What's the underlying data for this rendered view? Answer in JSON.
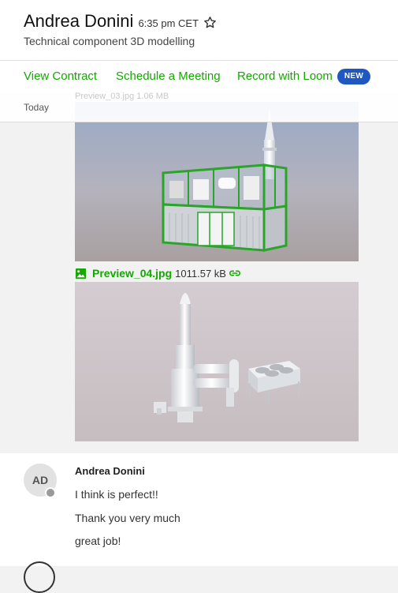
{
  "header": {
    "name": "Andrea Donini",
    "local_time": "6:35 pm CET",
    "subtitle": "Technical component 3D modelling"
  },
  "actions": {
    "view_contract": "View Contract",
    "schedule_meeting": "Schedule a Meeting",
    "record_loom": "Record with Loom",
    "new_badge": "NEW"
  },
  "thread": {
    "day_divider": "Today",
    "partial_filename": "Preview_03.jpg 1.06 MB",
    "attachment": {
      "filename": "Preview_04.jpg",
      "size": "1011.57 kB"
    }
  },
  "message": {
    "avatar_initials": "AD",
    "sender": "Andrea Donini",
    "lines": [
      "I think is perfect!!",
      "Thank you very much",
      "great job!"
    ]
  },
  "colors": {
    "accent": "#14a800",
    "badge": "#1f57c3"
  },
  "icons": {
    "favorite": "star-outline-icon",
    "attachment": "image-file-icon",
    "copy_link": "link-icon"
  }
}
